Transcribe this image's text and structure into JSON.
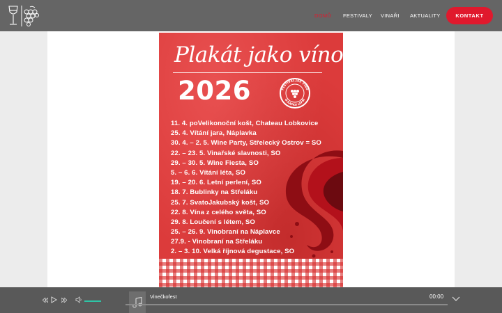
{
  "header": {
    "nav": [
      {
        "label": "DOMŮ",
        "active": true
      },
      {
        "label": "FESTIVALY",
        "active": false
      },
      {
        "label": "VINAŘI",
        "active": false
      },
      {
        "label": "AKTUALITY",
        "active": false
      }
    ],
    "contact_label": "KONTAKT"
  },
  "poster": {
    "title": "Plakát jako víno",
    "year": "2026",
    "stamp_text_top": "FESTIVAL JAK VÍNO",
    "stamp_text_bottom": "O.KAPKU LEPŠÍ",
    "events": [
      "11. 4. poVelikonoční košt, Chateau Lobkovice",
      "25. 4. Vítání jara, Náplavka",
      "30. 4. – 2. 5. Wine Party, Střelecký Ostrov = SO",
      "22. – 23. 5. Vinařské slavnosti, SO",
      "29. – 30. 5. Wine Fiesta, SO",
      "5. – 6. 6. Vítání léta, SO",
      "19. – 20. 6. Letní perlení, SO",
      "18. 7. Bublinky na Střeláku",
      "25. 7. SvatoJakubský košt, SO",
      "22. 8. Vína z celého světa, SO",
      "29. 8. Loučení s létem, SO",
      "25. – 26. 9. Vinobraní na Náplavce",
      "27.9. - Vinobraní na Střeláku",
      "2. – 3. 10. Velká říjnová degustace, SO"
    ]
  },
  "player": {
    "track_title": "Vinečkofest",
    "time": "00:00",
    "volume_level": 0.8
  },
  "colors": {
    "accent": "#e0192d",
    "topbar": "#656565",
    "player": "#595959",
    "volume": "#2ec4a6"
  },
  "icons": [
    "wine-glass-icon",
    "grapes-icon",
    "prev-icon",
    "play-icon",
    "next-icon",
    "volume-icon",
    "music-note-icon",
    "chevron-down-icon"
  ]
}
